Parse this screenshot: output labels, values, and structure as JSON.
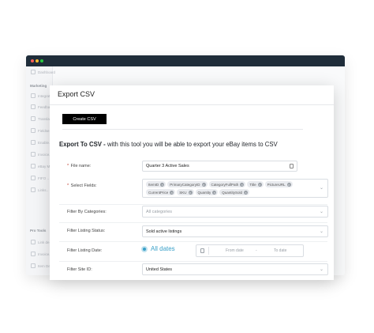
{
  "background_app": {
    "sidebar": {
      "top_item": "Dashboard",
      "section1": "Marketing",
      "items": [
        "Integrat..",
        "Feedba..",
        "Transla..",
        "Fieldse..",
        "Enable..",
        "Invoice..",
        "eBay Ma..",
        "FIFO ..",
        "Links.."
      ],
      "section2": "Pro Tools",
      "items2": [
        "Link de..",
        "Invoice..",
        "Item De.."
      ]
    }
  },
  "modal": {
    "title": "Export CSV",
    "create_button": "Create CSV",
    "heading_bold": "Export To CSV -",
    "heading_rest": " with this tool you will be able to export your eBay items to CSV",
    "file_name": {
      "label": "File name:",
      "value": "Quarter 3 Active Sales"
    },
    "select_fields": {
      "label": "Select Fields:",
      "chips_row1": [
        "ItemID",
        "PrimaryCategoryID",
        "CategoryFullPath",
        "Title",
        "PictureURL"
      ],
      "chips_row2": [
        "CurrentPrice",
        "SKU",
        "Quantity",
        "QuantitySold"
      ]
    },
    "filter_categories": {
      "label": "Filter By Categories:",
      "placeholder": "All categories"
    },
    "filter_listing_status": {
      "label": "Filter Listing Status:",
      "value": "Sold active listings"
    },
    "filter_listing_date": {
      "label": "Filter Listing Date:",
      "radio_label": "All dates",
      "from_placeholder": "From date",
      "dash": "-",
      "to_placeholder": "To date"
    },
    "filter_site": {
      "label": "Filter Site ID:",
      "value": "United States"
    }
  }
}
